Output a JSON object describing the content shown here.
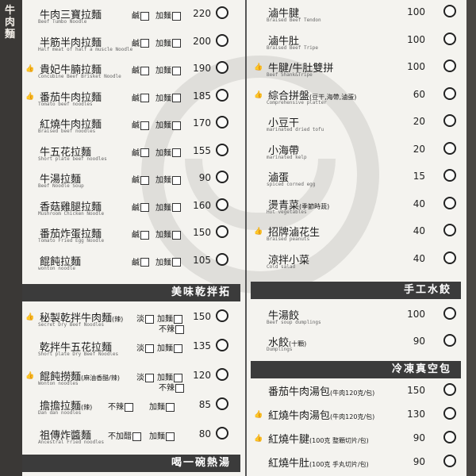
{
  "side_label": "牛肉麵",
  "left_noodles": [
    {
      "name": "牛肉三寶拉麵",
      "en": "Beef Tumbo Noodle",
      "options": [
        "鹹",
        "加麵"
      ],
      "price": "220"
    },
    {
      "name": "半筋半肉拉麵",
      "en": "Half meat of half a muscle Noodle",
      "options": [
        "鹹",
        "加麵"
      ],
      "price": "200"
    },
    {
      "name": "貴妃牛腩拉麵",
      "en": "Concubine Beef Brisket Noodle",
      "options": [
        "鹹",
        "加麵"
      ],
      "price": "190"
    },
    {
      "name": "番茄牛肉拉麵",
      "en": "Tomato beef noodles",
      "options": [
        "鹹",
        "加麵"
      ],
      "price": "185"
    },
    {
      "name": "紅燒牛肉拉麵",
      "en": "Braised beef noodles",
      "options": [
        "鹹",
        "加麵"
      ],
      "price": "170"
    },
    {
      "name": "牛五花拉麵",
      "en": "Short plate beef noodles",
      "options": [
        "鹹",
        "加麵"
      ],
      "price": "155"
    },
    {
      "name": "牛湯拉麵",
      "en": "Beef Noodle Soup",
      "options": [
        "鹹",
        "加麵"
      ],
      "price": "90"
    },
    {
      "name": "香菇雞腿拉麵",
      "en": "Mushroom Chicken Noodle",
      "options": [
        "鹹",
        "加麵"
      ],
      "price": "160"
    },
    {
      "name": "番茄炸蛋拉麵",
      "en": "Tomato Fried Egg Noodle",
      "options": [
        "鹹",
        "加麵"
      ],
      "price": "150"
    },
    {
      "name": "餛飩拉麵",
      "en": "wonton noodle",
      "options": [
        "鹹",
        "加麵"
      ],
      "price": "105"
    }
  ],
  "dry_header": "美味乾拌拓",
  "dry_noodles": [
    {
      "name": "秘製乾拌牛肉麵",
      "sub": "(辣)",
      "en": "Secret Dry Beef Noodles",
      "options": [
        "淡",
        "加麵"
      ],
      "options2": [
        "不辣"
      ],
      "price": "150"
    },
    {
      "name": "乾拌牛五花拉麵",
      "sub": "",
      "en": "Short plate Dry Beef Noodles",
      "options": [
        "淡",
        "加麵"
      ],
      "options2": [],
      "price": "135"
    },
    {
      "name": "餛飩撈麵",
      "sub": "(麻油香醋/辣)",
      "en": "Wonton noodles",
      "options": [
        "淡",
        "加麵"
      ],
      "options2": [
        "不辣"
      ],
      "price": "120"
    },
    {
      "name": "擔擔拉麵",
      "sub": "(辣)",
      "en": "Dan dan noodles",
      "options": [
        "不辣",
        "加麵"
      ],
      "options2": [],
      "price": "85"
    },
    {
      "name": "祖傳炸醬麵",
      "sub": "",
      "en": "Ancestral Fried noodles",
      "options": [
        "不加醋",
        "加麵"
      ],
      "options2": [],
      "price": "80"
    }
  ],
  "soup_header": "喝一碗熱湯",
  "right_sides": [
    {
      "name": "滷牛腱",
      "en": "Braised Beef Tendon",
      "price": "100"
    },
    {
      "name": "滷牛肚",
      "en": "Braised Beef Tripe",
      "price": "100"
    },
    {
      "name": "牛腱/牛肚雙拼",
      "en": "Beef Shank&Tripe",
      "price": "100"
    },
    {
      "name": "綜合拼盤",
      "sub": "(豆干,海帶,滷蛋)",
      "en": "Comprehensive platter",
      "price": "60"
    },
    {
      "name": "小豆干",
      "en": "marinated dried tofu",
      "price": "20"
    },
    {
      "name": "小海帶",
      "en": "marinated kelp",
      "price": "20"
    },
    {
      "name": "滷蛋",
      "en": "spiced corned egg",
      "price": "15"
    },
    {
      "name": "燙青菜",
      "sub": "(季節時蔬)",
      "en": "Hot vegetables",
      "price": "40"
    },
    {
      "name": "招牌滷花生",
      "en": "Braised peanuts",
      "price": "40"
    },
    {
      "name": "涼拌小菜",
      "en": "Cold salad",
      "price": "40"
    }
  ],
  "dumpling_header": "手工水餃",
  "dumplings": [
    {
      "name": "牛湯餃",
      "sub": "",
      "en": "Beef soup dumplings",
      "price": "100"
    },
    {
      "name": "水餃",
      "sub": "(十顆)",
      "en": "Dumplings",
      "price": "90"
    }
  ],
  "frozen_header": "冷凍真空包",
  "frozen": [
    {
      "name": "番茄牛肉湯包",
      "sub": "(牛肉120克/包)",
      "price": "150"
    },
    {
      "name": "紅燒牛肉湯包",
      "sub": "(牛肉120克/包)",
      "price": "130"
    },
    {
      "name": "紅燒牛腱",
      "sub": "(100克 整顆切片/包)",
      "price": "90"
    },
    {
      "name": "紅燒牛肚",
      "sub": "(100克 手丸切片/包)",
      "price": "90"
    }
  ]
}
